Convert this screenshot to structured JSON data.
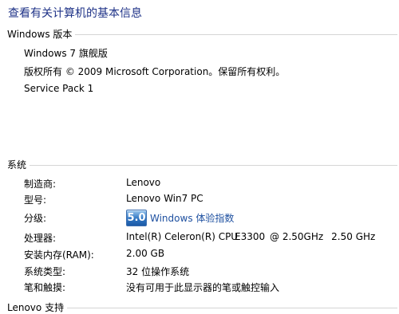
{
  "page_title": "查看有关计算机的基本信息",
  "windows_edition": {
    "header": "Windows 版本",
    "edition": "Windows 7 旗舰版",
    "copyright": "版权所有 © 2009 Microsoft Corporation。保留所有权利。",
    "service_pack": "Service Pack 1"
  },
  "system": {
    "header": "系统",
    "rows": [
      {
        "label": "制造商:",
        "value": "Lenovo"
      },
      {
        "label": "型号:",
        "value": "Lenovo Win7 PC"
      },
      {
        "label": "分级:",
        "score": "5.0",
        "link_text": "Windows 体验指数"
      },
      {
        "label": "处理器:",
        "cpu_parts": [
          "Intel(R) Celeron(R) CPU",
          "E3300",
          "@ 2.50GHz",
          "2.50 GHz"
        ]
      },
      {
        "label": "安装内存(RAM):",
        "value": "2.00 GB"
      },
      {
        "label": "系统类型:",
        "value": "32 位操作系统"
      },
      {
        "label": "笔和触摸:",
        "value": "没有可用于此显示器的笔或触控输入"
      }
    ]
  },
  "support": {
    "header": "Lenovo 支持"
  },
  "colors": {
    "title_text": "#1e3287",
    "link_text": "#1e50a0",
    "divider": "#d5d5d5",
    "badge_blue": "#2e74c2"
  }
}
